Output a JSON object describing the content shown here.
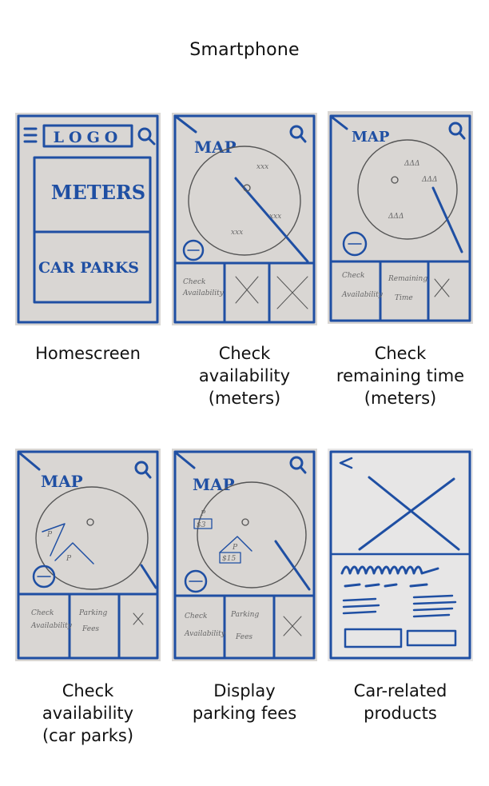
{
  "title": "Smartphone",
  "screens": [
    {
      "caption": [
        "Homescreen"
      ],
      "logo": "LOGO",
      "meters": "METERS",
      "car_parks": "CAR PARKS"
    },
    {
      "caption": [
        "Check",
        "availability",
        "(meters)"
      ],
      "map": "MAP",
      "tab1": [
        "Check",
        "Availability"
      ]
    },
    {
      "caption": [
        "Check",
        "remaining time",
        "(meters)"
      ],
      "map": "MAP",
      "tab1": [
        "Check",
        "Availability"
      ],
      "tab2": [
        "Remaining",
        "Time"
      ]
    },
    {
      "caption": [
        "Check",
        "availability",
        "(car parks)"
      ],
      "map": "MAP",
      "tab1": [
        "Check",
        "Availability"
      ],
      "tab2": [
        "Parking",
        "Fees"
      ]
    },
    {
      "caption": [
        "Display",
        "parking fees"
      ],
      "map": "MAP",
      "fee1": "$3",
      "fee2": "$15",
      "tab1": [
        "Check",
        "Availability"
      ],
      "tab2": [
        "Parking",
        "Fees"
      ]
    },
    {
      "caption": [
        "Car-related",
        "products"
      ]
    }
  ]
}
